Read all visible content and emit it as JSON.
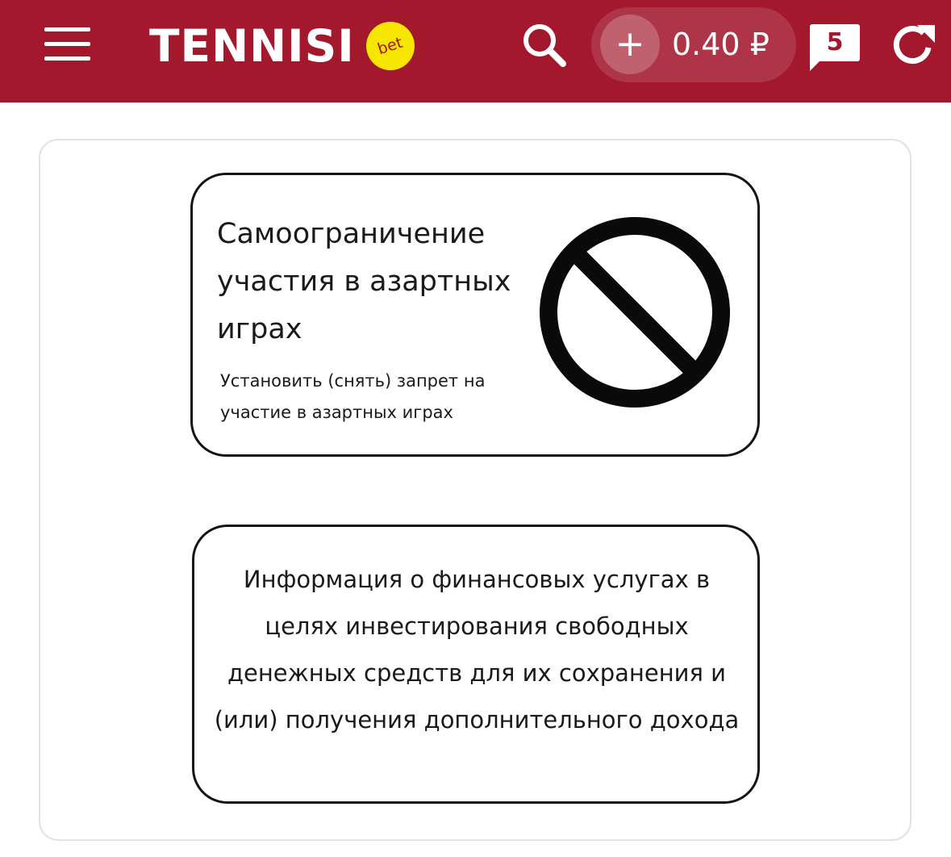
{
  "header": {
    "background_color": "#a3182c",
    "logo": {
      "text": "TENNISI",
      "badge": "bet",
      "badge_color": "#f7e600"
    },
    "icons": {
      "menu": "hamburger-menu-icon",
      "search": "search-icon",
      "add_funds": "plus-icon",
      "messages": "chat-bubble-icon",
      "refresh": "refresh-icon"
    },
    "add_funds_label": "+",
    "balance": "0.40 ₽",
    "messages_count": "5"
  },
  "content": {
    "self_restriction": {
      "title": "Самоограничение участия в азартных играх",
      "subtitle": "Установить (снять) запрет на участие в азартных играх",
      "icon": "prohibition-icon"
    },
    "financial_info": {
      "text": "Информация о финансовых услугах в целях инвестирования свободных денежных средств для их сохранения и (или) получения дополнительного дохода"
    }
  }
}
